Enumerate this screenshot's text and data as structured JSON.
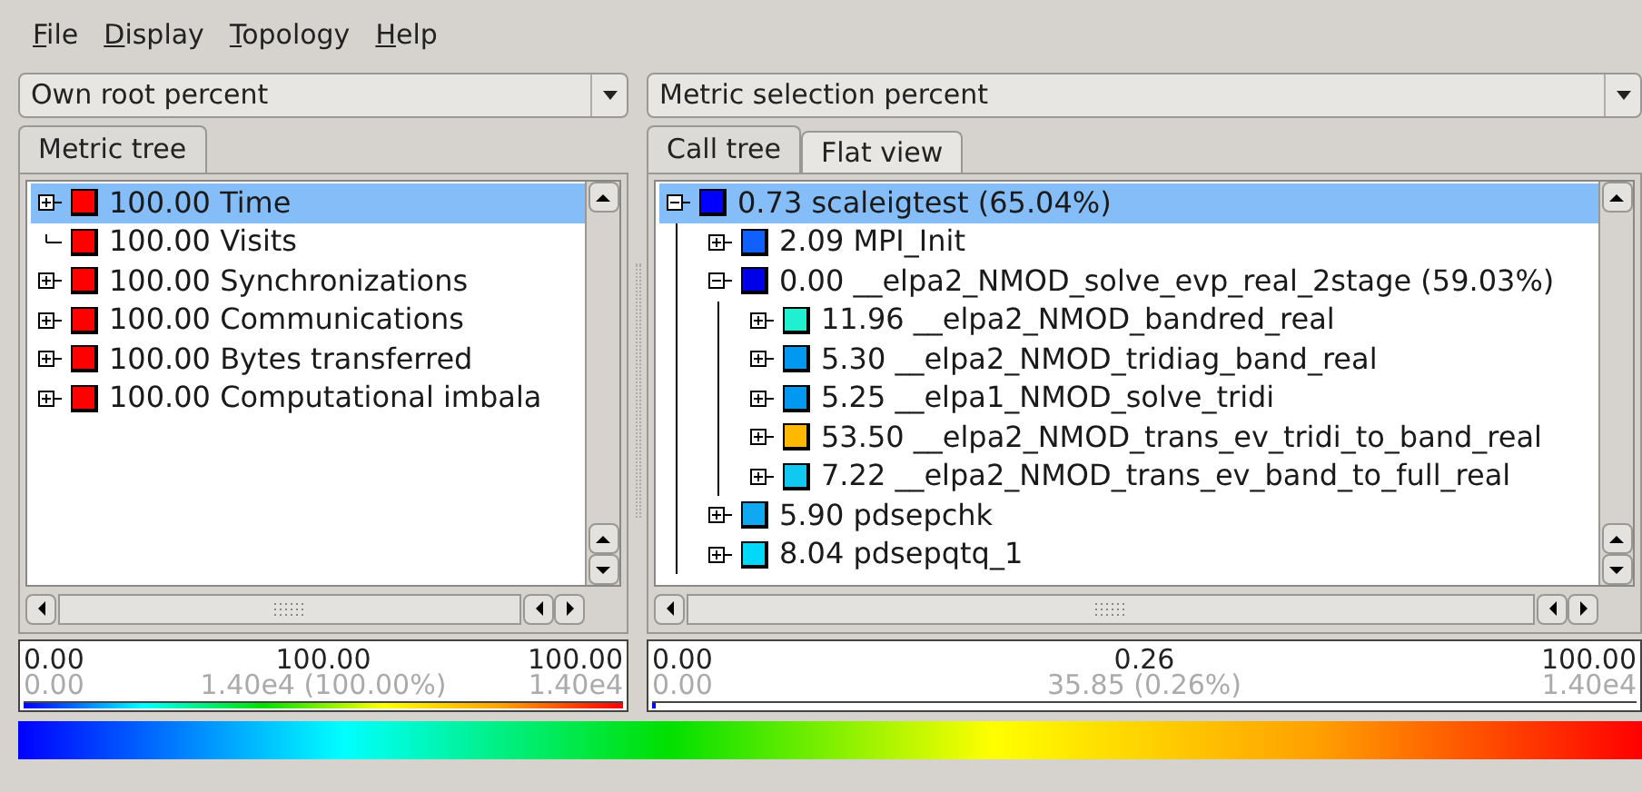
{
  "menu": [
    {
      "label": "File"
    },
    {
      "label": "Display"
    },
    {
      "label": "Topology"
    },
    {
      "label": "Help"
    }
  ],
  "panels": [
    {
      "dropdown": {
        "value": "Own root percent"
      },
      "tabs": [
        {
          "label": "Metric tree",
          "selected": true
        }
      ],
      "tree": [
        {
          "text": "100.00 Time",
          "color": "#ff0000",
          "kind": "node",
          "expanded": false,
          "selected": true
        },
        {
          "text": "100.00 Visits",
          "color": "#ff0000",
          "kind": "leaf",
          "expanded": false,
          "selected": false
        },
        {
          "text": "100.00 Synchronizations",
          "color": "#ff0000",
          "kind": "node",
          "expanded": false,
          "selected": false
        },
        {
          "text": "100.00 Communications",
          "color": "#ff0000",
          "kind": "node",
          "expanded": false,
          "selected": false
        },
        {
          "text": "100.00 Bytes transferred",
          "color": "#ff0000",
          "kind": "node",
          "expanded": false,
          "selected": false
        },
        {
          "text": "100.00 Computational imbala",
          "color": "#ff0000",
          "kind": "node",
          "expanded": false,
          "selected": false
        }
      ],
      "legend": {
        "min": "0.00",
        "mid": "100.00",
        "max": "100.00",
        "min_abs": "0.00",
        "mid_abs": "1.40e4 (100.00%)",
        "max_abs": "1.40e4",
        "level": 1
      }
    },
    {
      "dropdown": {
        "value": "Metric selection percent"
      },
      "tabs": [
        {
          "label": "Call tree",
          "selected": true
        },
        {
          "label": "Flat view",
          "selected": false
        }
      ],
      "tree": [
        {
          "text": "0.73 scaleigtest (65.04%)",
          "color": "#0000ff",
          "kind": "node",
          "expanded": true,
          "selected": true,
          "children": [
            {
              "text": "2.09 MPI_Init",
              "color": "#1060ff",
              "kind": "node",
              "expanded": false,
              "selected": false
            },
            {
              "text": "0.00 __elpa2_NMOD_solve_evp_real_2stage (59.03%)",
              "color": "#0000e8",
              "kind": "node",
              "expanded": true,
              "selected": false,
              "children": [
                {
                  "text": "11.96 __elpa2_NMOD_bandred_real",
                  "color": "#20f0d0",
                  "kind": "node",
                  "expanded": false,
                  "selected": false
                },
                {
                  "text": "5.30 __elpa2_NMOD_tridiag_band_real",
                  "color": "#0098f0",
                  "kind": "node",
                  "expanded": false,
                  "selected": false
                },
                {
                  "text": "5.25 __elpa1_NMOD_solve_tridi",
                  "color": "#0098f0",
                  "kind": "node",
                  "expanded": false,
                  "selected": false
                },
                {
                  "text": "53.50 __elpa2_NMOD_trans_ev_tridi_to_band_real",
                  "color": "#ffb800",
                  "kind": "node",
                  "expanded": false,
                  "selected": false
                },
                {
                  "text": "7.22 __elpa2_NMOD_trans_ev_band_to_full_real",
                  "color": "#10c8f0",
                  "kind": "node",
                  "expanded": false,
                  "selected": false
                }
              ]
            },
            {
              "text": "5.90 pdsepchk",
              "color": "#10a8f0",
              "kind": "node",
              "expanded": false,
              "selected": false
            },
            {
              "text": "8.04 pdsepqtq_1",
              "color": "#00d8f8",
              "kind": "node",
              "expanded": false,
              "selected": false
            }
          ]
        }
      ],
      "legend": {
        "min": "0.00",
        "mid": "0.26",
        "max": "100.00",
        "min_abs": "0.00",
        "mid_abs": "35.85 (0.26%)",
        "max_abs": "1.40e4",
        "level": 0.0026
      }
    }
  ]
}
